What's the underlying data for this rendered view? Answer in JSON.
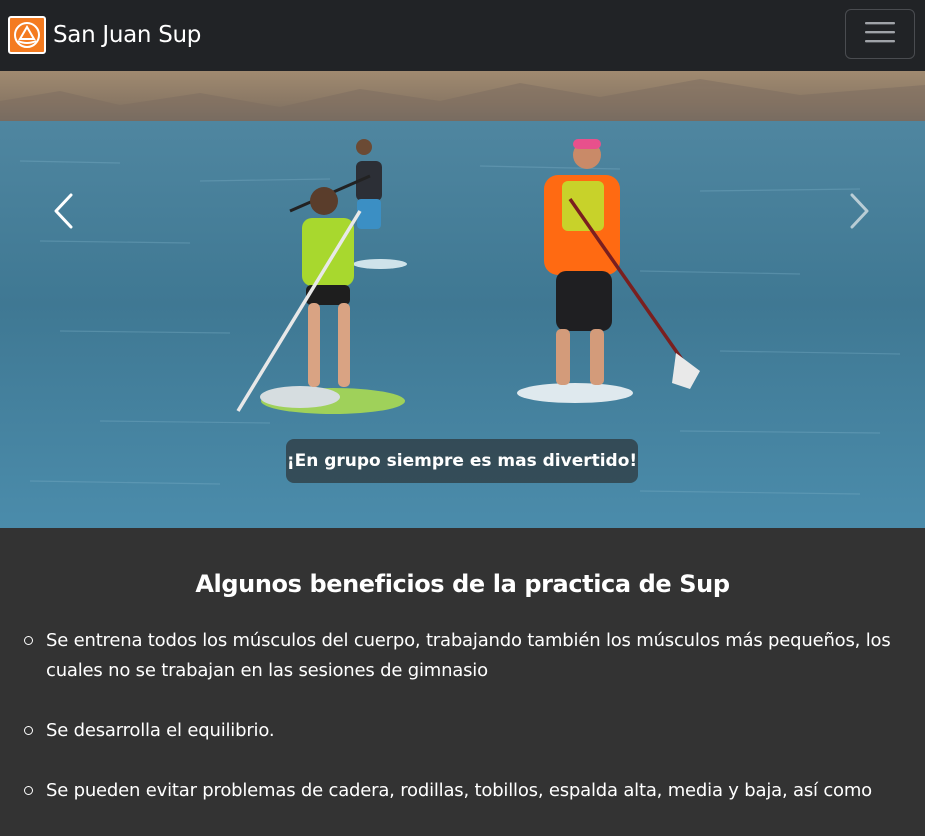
{
  "navbar": {
    "brand_name": "San Juan Sup",
    "logo_icon": "sup-logo-icon",
    "toggler_icon": "hamburger-menu-icon"
  },
  "carousel": {
    "caption": "¡En grupo siempre es mas divertido!",
    "prev_icon": "chevron-left-icon",
    "next_icon": "chevron-right-icon"
  },
  "content": {
    "title": "Algunos beneficios de la practica de Sup",
    "benefits": [
      "Se entrena todos los músculos del cuerpo, trabajando también los músculos más pequeños, los cuales no se trabajan en las sesiones de gimnasio",
      "Se desarrolla el equilibrio.",
      "Se pueden evitar problemas de cadera, rodillas, tobillos, espalda alta, media y baja, así como"
    ]
  },
  "colors": {
    "navbar_bg": "#212326",
    "page_bg": "#333333",
    "brand_orange": "#f47b20"
  }
}
